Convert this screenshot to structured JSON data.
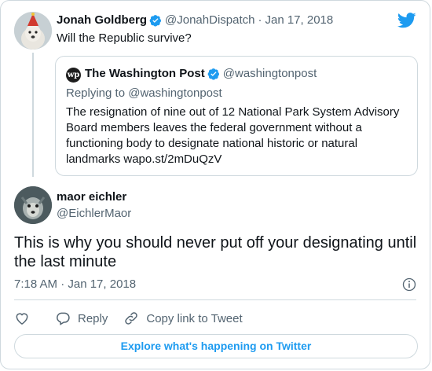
{
  "tweet1": {
    "name": "Jonah Goldberg",
    "handle": "@JonahDispatch",
    "separator": "·",
    "date": "Jan 17, 2018",
    "text": "Will the Republic survive?"
  },
  "quote": {
    "name": "The Washington Post",
    "handle": "@washingtonpost",
    "replying": "Replying to @washingtonpost",
    "text": "The resignation of nine out of 12 National Park System Advisory Board members leaves the federal government without a functioning body to designate national historic or natural landmarks wapo.st/2mDuQzV",
    "logo_text": "wp"
  },
  "tweet2": {
    "name": "maor eichler",
    "handle": "@EichlerMaor",
    "text": "This is why you should never put off your designating until the last minute",
    "time": "7:18 AM · Jan 17, 2018"
  },
  "actions": {
    "reply_label": "Reply",
    "copy_label": "Copy link to Tweet"
  },
  "explore_label": "Explore what's happening on Twitter",
  "colors": {
    "accent": "#1d9bf0",
    "muted": "#536471",
    "border": "#cfd9de"
  },
  "icons": [
    "twitter-bird-icon",
    "verified-icon",
    "info-icon",
    "heart-icon",
    "reply-icon",
    "link-icon"
  ]
}
